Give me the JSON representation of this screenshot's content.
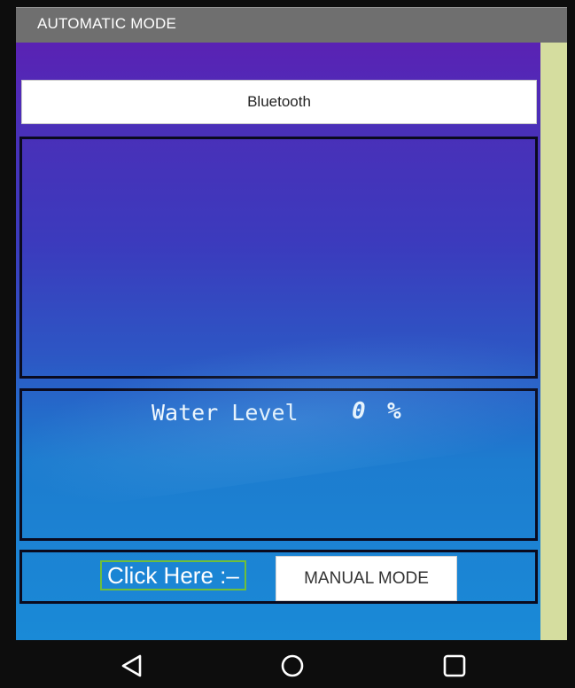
{
  "app": {
    "title": "AUTOMATIC MODE"
  },
  "bluetooth": {
    "label": "Bluetooth"
  },
  "water": {
    "label": "Water Level",
    "value": "0",
    "unit": "%"
  },
  "controls": {
    "click_label": "Click Here :–",
    "manual_button": "MANUAL MODE"
  },
  "navbar": {
    "icons": [
      "back-icon",
      "home-icon",
      "recent-apps-icon"
    ]
  },
  "colors": {
    "titlebar": "#6f6f6f",
    "side_strip": "#d5dd9f",
    "click_border": "#6fbf3a",
    "gradient_top": "#5a22b4",
    "gradient_bottom": "#1a8ad7"
  }
}
